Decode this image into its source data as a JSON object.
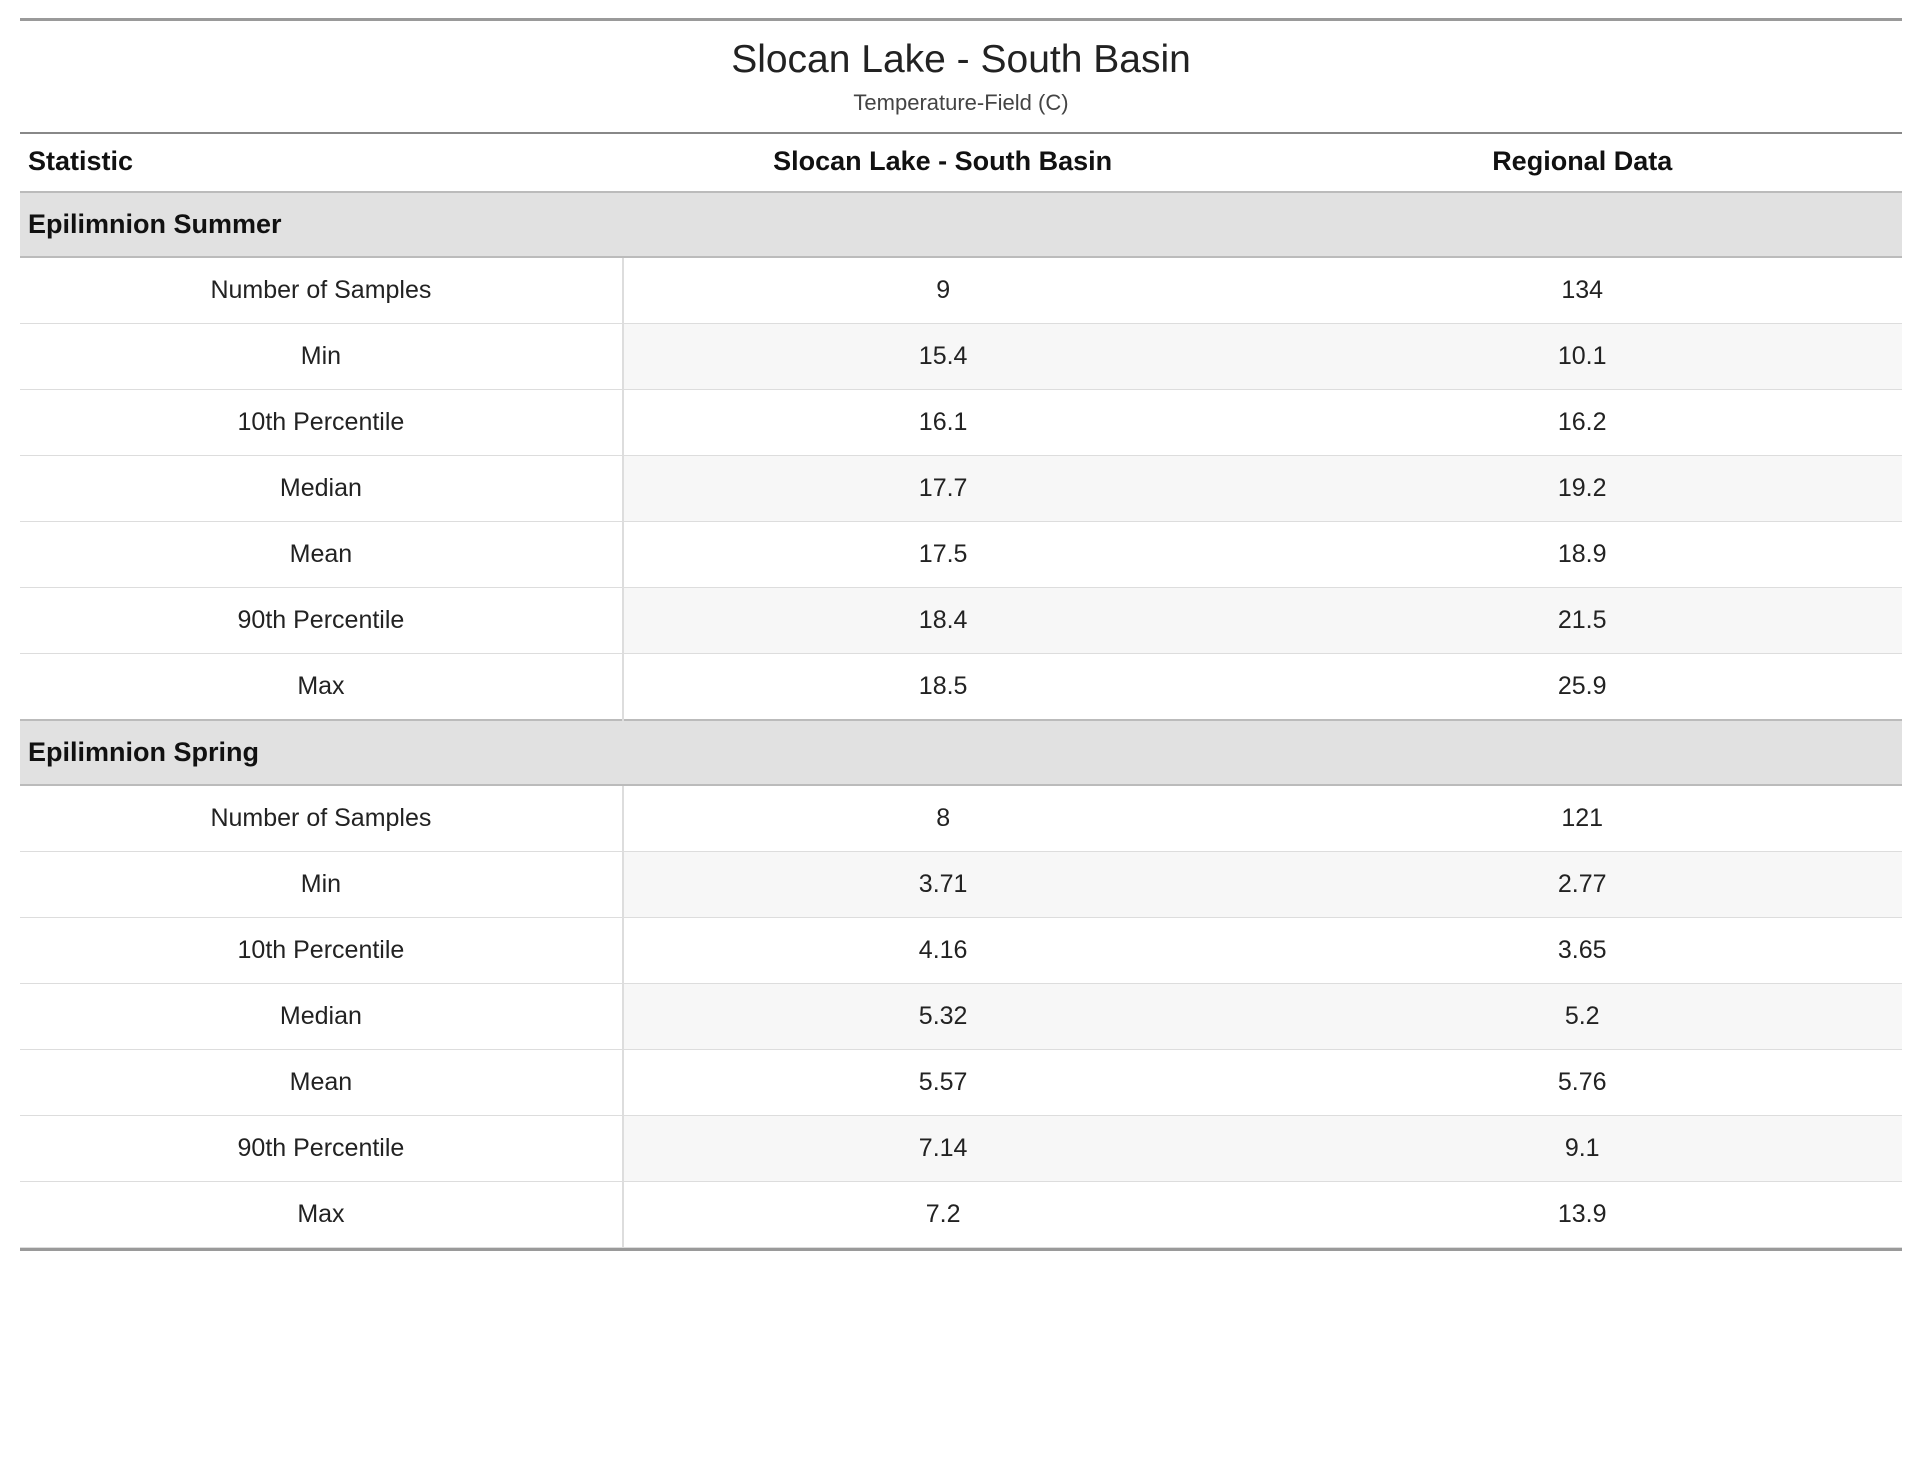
{
  "title": "Slocan Lake - South Basin",
  "subtitle": "Temperature-Field (C)",
  "columns": {
    "stat": "Statistic",
    "site": "Slocan Lake - South Basin",
    "regional": "Regional Data"
  },
  "sections": [
    {
      "name": "Epilimnion Summer",
      "rows": [
        {
          "label": "Number of Samples",
          "site": "9",
          "regional": "134"
        },
        {
          "label": "Min",
          "site": "15.4",
          "regional": "10.1"
        },
        {
          "label": "10th Percentile",
          "site": "16.1",
          "regional": "16.2"
        },
        {
          "label": "Median",
          "site": "17.7",
          "regional": "19.2"
        },
        {
          "label": "Mean",
          "site": "17.5",
          "regional": "18.9"
        },
        {
          "label": "90th Percentile",
          "site": "18.4",
          "regional": "21.5"
        },
        {
          "label": "Max",
          "site": "18.5",
          "regional": "25.9"
        }
      ]
    },
    {
      "name": "Epilimnion Spring",
      "rows": [
        {
          "label": "Number of Samples",
          "site": "8",
          "regional": "121"
        },
        {
          "label": "Min",
          "site": "3.71",
          "regional": "2.77"
        },
        {
          "label": "10th Percentile",
          "site": "4.16",
          "regional": "3.65"
        },
        {
          "label": "Median",
          "site": "5.32",
          "regional": "5.2"
        },
        {
          "label": "Mean",
          "site": "5.57",
          "regional": "5.76"
        },
        {
          "label": "90th Percentile",
          "site": "7.14",
          "regional": "9.1"
        },
        {
          "label": "Max",
          "site": "7.2",
          "regional": "13.9"
        }
      ]
    }
  ],
  "chart_data": {
    "type": "table",
    "title": "Slocan Lake - South Basin — Temperature-Field (C)",
    "series": [
      {
        "name": "Epilimnion Summer",
        "columns": [
          "Statistic",
          "Slocan Lake - South Basin",
          "Regional Data"
        ],
        "rows": [
          [
            "Number of Samples",
            9,
            134
          ],
          [
            "Min",
            15.4,
            10.1
          ],
          [
            "10th Percentile",
            16.1,
            16.2
          ],
          [
            "Median",
            17.7,
            19.2
          ],
          [
            "Mean",
            17.5,
            18.9
          ],
          [
            "90th Percentile",
            18.4,
            21.5
          ],
          [
            "Max",
            18.5,
            25.9
          ]
        ]
      },
      {
        "name": "Epilimnion Spring",
        "columns": [
          "Statistic",
          "Slocan Lake - South Basin",
          "Regional Data"
        ],
        "rows": [
          [
            "Number of Samples",
            8,
            121
          ],
          [
            "Min",
            3.71,
            2.77
          ],
          [
            "10th Percentile",
            4.16,
            3.65
          ],
          [
            "Median",
            5.32,
            5.2
          ],
          [
            "Mean",
            5.57,
            5.76
          ],
          [
            "90th Percentile",
            7.14,
            9.1
          ],
          [
            "Max",
            7.2,
            13.9
          ]
        ]
      }
    ]
  }
}
